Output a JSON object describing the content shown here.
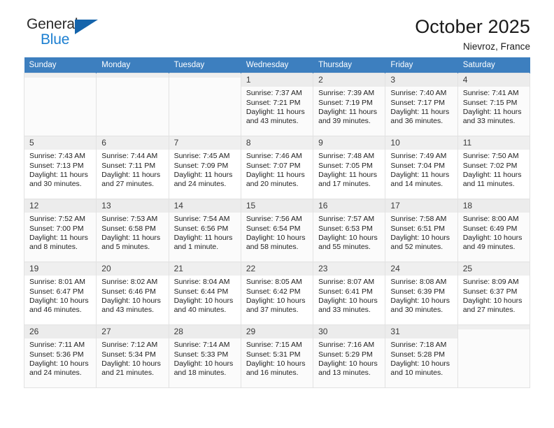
{
  "brand": {
    "name_top": "General",
    "name_bottom": "Blue",
    "triangle_color": "#1564ab",
    "blue_color": "#1c7fd1"
  },
  "header": {
    "title": "October 2025",
    "subtitle": "Nievroz, France"
  },
  "calendar": {
    "header_bg": "#3d7fbf",
    "weekdays": [
      "Sunday",
      "Monday",
      "Tuesday",
      "Wednesday",
      "Thursday",
      "Friday",
      "Saturday"
    ],
    "labels": {
      "sunrise": "Sunrise:",
      "sunset": "Sunset:",
      "daylight": "Daylight:"
    },
    "weeks": [
      [
        {
          "day": "",
          "empty": true
        },
        {
          "day": "",
          "empty": true
        },
        {
          "day": "",
          "empty": true
        },
        {
          "day": "1",
          "sunrise": "Sunrise: 7:37 AM",
          "sunset": "Sunset: 7:21 PM",
          "daylight": "Daylight: 11 hours and 43 minutes."
        },
        {
          "day": "2",
          "sunrise": "Sunrise: 7:39 AM",
          "sunset": "Sunset: 7:19 PM",
          "daylight": "Daylight: 11 hours and 39 minutes."
        },
        {
          "day": "3",
          "sunrise": "Sunrise: 7:40 AM",
          "sunset": "Sunset: 7:17 PM",
          "daylight": "Daylight: 11 hours and 36 minutes."
        },
        {
          "day": "4",
          "sunrise": "Sunrise: 7:41 AM",
          "sunset": "Sunset: 7:15 PM",
          "daylight": "Daylight: 11 hours and 33 minutes."
        }
      ],
      [
        {
          "day": "5",
          "sunrise": "Sunrise: 7:43 AM",
          "sunset": "Sunset: 7:13 PM",
          "daylight": "Daylight: 11 hours and 30 minutes."
        },
        {
          "day": "6",
          "sunrise": "Sunrise: 7:44 AM",
          "sunset": "Sunset: 7:11 PM",
          "daylight": "Daylight: 11 hours and 27 minutes."
        },
        {
          "day": "7",
          "sunrise": "Sunrise: 7:45 AM",
          "sunset": "Sunset: 7:09 PM",
          "daylight": "Daylight: 11 hours and 24 minutes."
        },
        {
          "day": "8",
          "sunrise": "Sunrise: 7:46 AM",
          "sunset": "Sunset: 7:07 PM",
          "daylight": "Daylight: 11 hours and 20 minutes."
        },
        {
          "day": "9",
          "sunrise": "Sunrise: 7:48 AM",
          "sunset": "Sunset: 7:05 PM",
          "daylight": "Daylight: 11 hours and 17 minutes."
        },
        {
          "day": "10",
          "sunrise": "Sunrise: 7:49 AM",
          "sunset": "Sunset: 7:04 PM",
          "daylight": "Daylight: 11 hours and 14 minutes."
        },
        {
          "day": "11",
          "sunrise": "Sunrise: 7:50 AM",
          "sunset": "Sunset: 7:02 PM",
          "daylight": "Daylight: 11 hours and 11 minutes."
        }
      ],
      [
        {
          "day": "12",
          "sunrise": "Sunrise: 7:52 AM",
          "sunset": "Sunset: 7:00 PM",
          "daylight": "Daylight: 11 hours and 8 minutes."
        },
        {
          "day": "13",
          "sunrise": "Sunrise: 7:53 AM",
          "sunset": "Sunset: 6:58 PM",
          "daylight": "Daylight: 11 hours and 5 minutes."
        },
        {
          "day": "14",
          "sunrise": "Sunrise: 7:54 AM",
          "sunset": "Sunset: 6:56 PM",
          "daylight": "Daylight: 11 hours and 1 minute."
        },
        {
          "day": "15",
          "sunrise": "Sunrise: 7:56 AM",
          "sunset": "Sunset: 6:54 PM",
          "daylight": "Daylight: 10 hours and 58 minutes."
        },
        {
          "day": "16",
          "sunrise": "Sunrise: 7:57 AM",
          "sunset": "Sunset: 6:53 PM",
          "daylight": "Daylight: 10 hours and 55 minutes."
        },
        {
          "day": "17",
          "sunrise": "Sunrise: 7:58 AM",
          "sunset": "Sunset: 6:51 PM",
          "daylight": "Daylight: 10 hours and 52 minutes."
        },
        {
          "day": "18",
          "sunrise": "Sunrise: 8:00 AM",
          "sunset": "Sunset: 6:49 PM",
          "daylight": "Daylight: 10 hours and 49 minutes."
        }
      ],
      [
        {
          "day": "19",
          "sunrise": "Sunrise: 8:01 AM",
          "sunset": "Sunset: 6:47 PM",
          "daylight": "Daylight: 10 hours and 46 minutes."
        },
        {
          "day": "20",
          "sunrise": "Sunrise: 8:02 AM",
          "sunset": "Sunset: 6:46 PM",
          "daylight": "Daylight: 10 hours and 43 minutes."
        },
        {
          "day": "21",
          "sunrise": "Sunrise: 8:04 AM",
          "sunset": "Sunset: 6:44 PM",
          "daylight": "Daylight: 10 hours and 40 minutes."
        },
        {
          "day": "22",
          "sunrise": "Sunrise: 8:05 AM",
          "sunset": "Sunset: 6:42 PM",
          "daylight": "Daylight: 10 hours and 37 minutes."
        },
        {
          "day": "23",
          "sunrise": "Sunrise: 8:07 AM",
          "sunset": "Sunset: 6:41 PM",
          "daylight": "Daylight: 10 hours and 33 minutes."
        },
        {
          "day": "24",
          "sunrise": "Sunrise: 8:08 AM",
          "sunset": "Sunset: 6:39 PM",
          "daylight": "Daylight: 10 hours and 30 minutes."
        },
        {
          "day": "25",
          "sunrise": "Sunrise: 8:09 AM",
          "sunset": "Sunset: 6:37 PM",
          "daylight": "Daylight: 10 hours and 27 minutes."
        }
      ],
      [
        {
          "day": "26",
          "sunrise": "Sunrise: 7:11 AM",
          "sunset": "Sunset: 5:36 PM",
          "daylight": "Daylight: 10 hours and 24 minutes."
        },
        {
          "day": "27",
          "sunrise": "Sunrise: 7:12 AM",
          "sunset": "Sunset: 5:34 PM",
          "daylight": "Daylight: 10 hours and 21 minutes."
        },
        {
          "day": "28",
          "sunrise": "Sunrise: 7:14 AM",
          "sunset": "Sunset: 5:33 PM",
          "daylight": "Daylight: 10 hours and 18 minutes."
        },
        {
          "day": "29",
          "sunrise": "Sunrise: 7:15 AM",
          "sunset": "Sunset: 5:31 PM",
          "daylight": "Daylight: 10 hours and 16 minutes."
        },
        {
          "day": "30",
          "sunrise": "Sunrise: 7:16 AM",
          "sunset": "Sunset: 5:29 PM",
          "daylight": "Daylight: 10 hours and 13 minutes."
        },
        {
          "day": "31",
          "sunrise": "Sunrise: 7:18 AM",
          "sunset": "Sunset: 5:28 PM",
          "daylight": "Daylight: 10 hours and 10 minutes."
        },
        {
          "day": "",
          "empty": true
        }
      ]
    ]
  }
}
